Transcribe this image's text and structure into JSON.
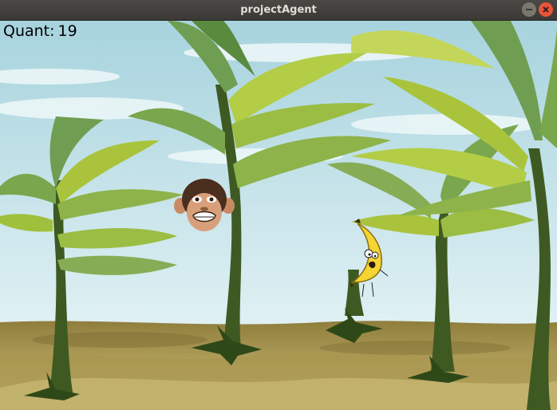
{
  "window": {
    "title": "projectAgent",
    "controls": [
      "minimize",
      "close"
    ]
  },
  "hud": {
    "score_label": "Quant:",
    "score_value": "19"
  },
  "sprites": {
    "player": "monkey",
    "target": "banana"
  },
  "colors": {
    "sky_top": "#aed6e0",
    "sky_bottom": "#d9eef2",
    "ground": "#9c8a4a",
    "leaf_light": "#a8c23a",
    "leaf_dark": "#6f9e52",
    "trunk": "#3e5a22",
    "banana_yellow": "#f4d533"
  }
}
